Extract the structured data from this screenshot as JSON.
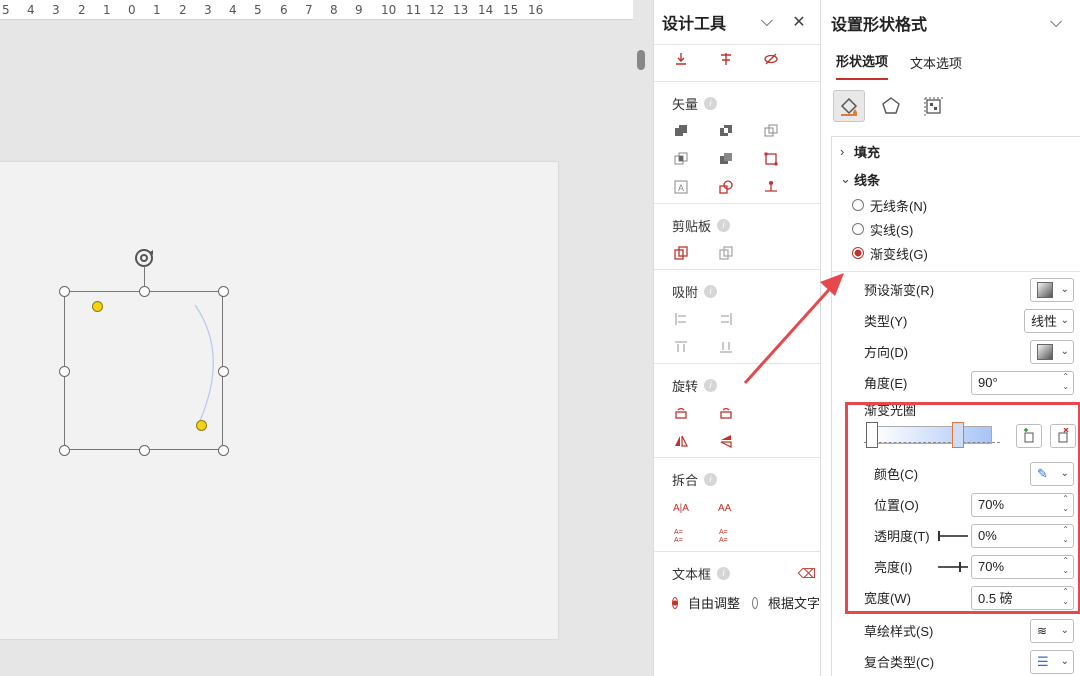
{
  "ruler": {
    "numbers": [
      "5",
      "4",
      "3",
      "2",
      "1",
      "0",
      "1",
      "2",
      "3",
      "4",
      "5",
      "6",
      "7",
      "8",
      "9",
      "10",
      "11",
      "12",
      "13",
      "14",
      "15",
      "16"
    ]
  },
  "design_tools": {
    "title": "设计工具",
    "sections": {
      "vector": "矢量",
      "clipboard": "剪贴板",
      "snap": "吸附",
      "rotate": "旋转",
      "split": "拆合",
      "textbox": "文本框"
    },
    "textbox_options": [
      "自由调整",
      "根据文字"
    ]
  },
  "format": {
    "title": "设置形状格式",
    "tabs": [
      "形状选项",
      "文本选项"
    ],
    "fill": "填充",
    "line": "线条",
    "line_options": [
      "无线条(N)",
      "实线(S)",
      "渐变线(G)"
    ],
    "preset_gradient": "预设渐变(R)",
    "type_label": "类型(Y)",
    "type_value": "线性",
    "direction": "方向(D)",
    "angle_label": "角度(E)",
    "angle_value": "90°",
    "gradient_stops": "渐变光圈",
    "color_label": "颜色(C)",
    "position_label": "位置(O)",
    "position_value": "70%",
    "transparency_label": "透明度(T)",
    "transparency_value": "0%",
    "brightness_label": "亮度(I)",
    "brightness_value": "70%",
    "width_label": "宽度(W)",
    "width_value": "0.5 磅",
    "sketch_style": "草绘样式(S)",
    "compound_type": "复合类型(C)"
  },
  "colors": {
    "accent": "#c4312b",
    "highlight": "#e5484d",
    "arrow": "#e5484d"
  }
}
